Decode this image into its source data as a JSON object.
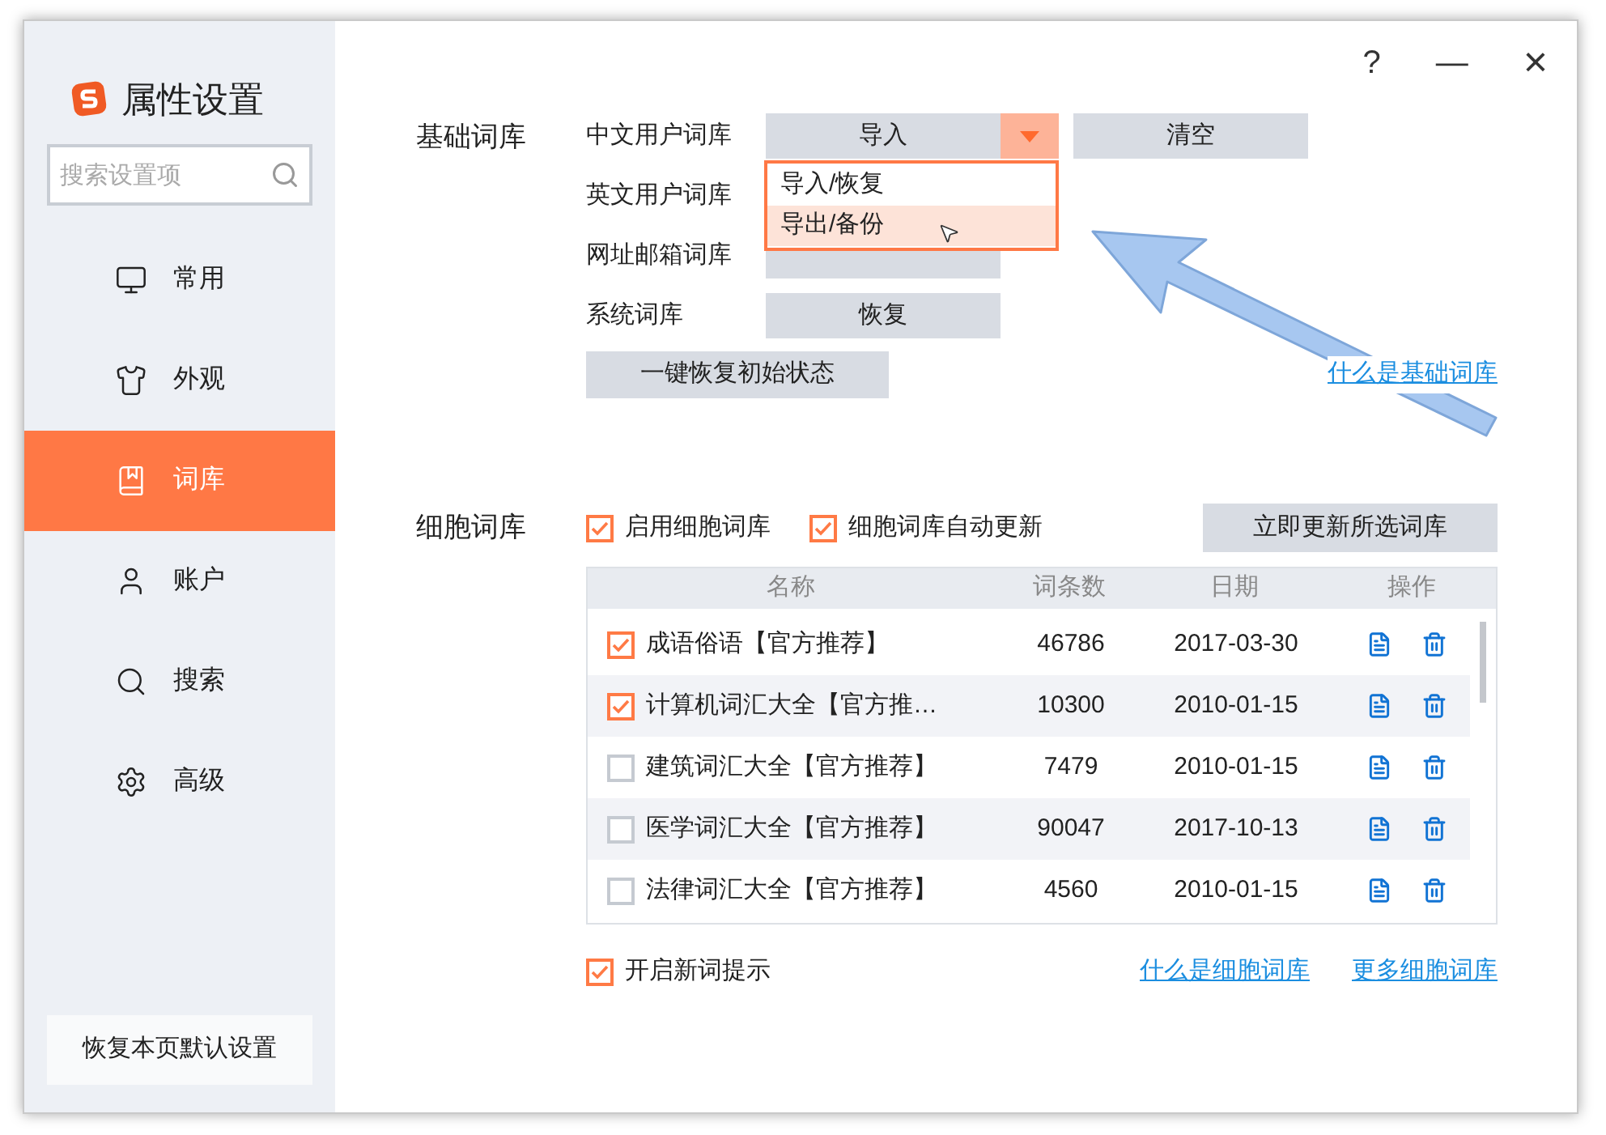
{
  "window": {
    "help": "?",
    "minimize": "—",
    "close": "×"
  },
  "sidebar": {
    "title": "属性设置",
    "search": {
      "placeholder": "搜索设置项"
    },
    "items": [
      {
        "label": "常用",
        "selected": false
      },
      {
        "label": "外观",
        "selected": false
      },
      {
        "label": "词库",
        "selected": true
      },
      {
        "label": "账户",
        "selected": false
      },
      {
        "label": "搜索",
        "selected": false
      },
      {
        "label": "高级",
        "selected": false
      }
    ],
    "reset_button": "恢复本页默认设置"
  },
  "basic": {
    "label": "基础词库",
    "rows": [
      {
        "label": "中文用户词库",
        "buttons": [
          {
            "label": "导入",
            "dropdown": true
          },
          {
            "label": "清空",
            "dropdown": false
          }
        ]
      },
      {
        "label": "英文用户词库"
      },
      {
        "label": "网址邮箱词库",
        "buttons": [
          {
            "dropdown": false
          }
        ]
      },
      {
        "label": "系统词库",
        "buttons": [
          {
            "label": "恢复",
            "dropdown": false
          }
        ]
      }
    ],
    "reset_button": "一键恢复初始状态",
    "link": "什么是基础词库",
    "dropdown_menu": [
      {
        "label": "导入/恢复",
        "selected": false
      },
      {
        "label": "导出/备份",
        "selected": true
      }
    ]
  },
  "cell": {
    "label": "细胞词库",
    "options": [
      {
        "label": "启用细胞词库",
        "checked": true
      },
      {
        "label": "细胞词库自动更新",
        "checked": true
      }
    ],
    "update_button": "立即更新所选词库",
    "table": {
      "columns": [
        "名称",
        "词条数",
        "日期",
        "操作"
      ],
      "rows": [
        {
          "checked": true,
          "name": "成语俗语【官方推荐】",
          "count": "46786",
          "date": "2017-03-30"
        },
        {
          "checked": true,
          "name": "计算机词汇大全【官方推…",
          "count": "10300",
          "date": "2010-01-15"
        },
        {
          "checked": false,
          "name": "建筑词汇大全【官方推荐】",
          "count": "7479",
          "date": "2010-01-15"
        },
        {
          "checked": false,
          "name": "医学词汇大全【官方推荐】",
          "count": "90047",
          "date": "2017-10-13"
        },
        {
          "checked": false,
          "name": "法律词汇大全【官方推荐】",
          "count": "4560",
          "date": "2010-01-15"
        }
      ]
    },
    "new_word_tip": {
      "label": "开启新词提示",
      "checked": true
    },
    "links": [
      "什么是细胞词库",
      "更多细胞词库"
    ]
  }
}
